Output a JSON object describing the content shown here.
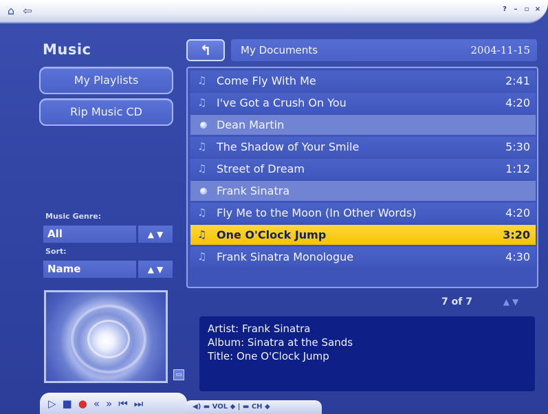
{
  "topbar": {
    "icons": [
      "home-icon",
      "back-icon"
    ],
    "controls": [
      "help-icon",
      "minimize-icon",
      "restore-icon",
      "close-icon"
    ]
  },
  "sidebar": {
    "title": "Music",
    "buttons": [
      "My Playlists",
      "Rip Music CD"
    ],
    "genre_label": "Music Genre:",
    "genre_value": "All",
    "sort_label": "Sort:",
    "sort_value": "Name"
  },
  "folder": {
    "name": "My Documents",
    "date": "2004-11-15"
  },
  "list": [
    {
      "type": "song",
      "title": "Come Fly With Me",
      "duration": "2:41"
    },
    {
      "type": "song",
      "title": "I've Got a Crush On You",
      "duration": "4:20"
    },
    {
      "type": "artist",
      "title": "Dean Martin",
      "duration": ""
    },
    {
      "type": "song",
      "title": "The Shadow of Your Smile",
      "duration": "5:30"
    },
    {
      "type": "song",
      "title": "Street of Dream",
      "duration": "1:12"
    },
    {
      "type": "artist",
      "title": "Frank Sinatra",
      "duration": ""
    },
    {
      "type": "song",
      "title": "Fly Me to the Moon (In Other Words)",
      "duration": "4:20"
    },
    {
      "type": "song",
      "title": "One O'Clock Jump",
      "duration": "3:20",
      "selected": true
    },
    {
      "type": "song",
      "title": "Frank Sinatra Monologue",
      "duration": "4:30"
    }
  ],
  "pager": {
    "text": "7 of 7"
  },
  "info": {
    "artist": "Artist: Frank Sinatra",
    "album": "Album: Sinatra at the Sands",
    "title": "Title: One O'Clock Jump"
  },
  "transport": {
    "buttons": [
      "play-icon",
      "stop-icon",
      "record-icon",
      "rewind-icon",
      "fast-forward-icon",
      "skip-back-icon",
      "skip-forward-icon"
    ],
    "vol_ch": "◀) ▬ VOL ◆ | ▬ CH ◆"
  },
  "colors": {
    "background": "#3346a6",
    "selected_row": "#f4c200",
    "info_box": "#0e1f88"
  }
}
